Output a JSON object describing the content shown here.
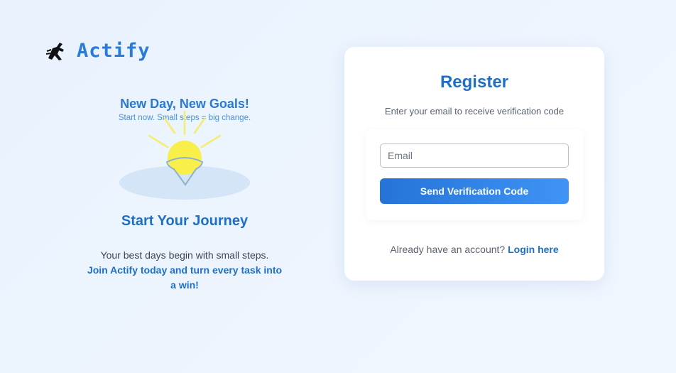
{
  "brand": {
    "name": "Actify",
    "logo_icon": "runner-logo-icon",
    "color": "#2a7bd6"
  },
  "hero": {
    "heading": "New Day, New Goals!",
    "subheading": "Start now. Small steps = big change.",
    "illustration_icon": "sunrise-icon",
    "journey_title": "Start Your Journey",
    "journey_text": "Your best days begin with small steps.",
    "journey_highlight": "Join Actify today and turn every task into a win!"
  },
  "register": {
    "title": "Register",
    "subtitle": "Enter your email to receive verification code",
    "email_placeholder": "Email",
    "email_value": "",
    "send_button": "Send Verification Code",
    "login_prompt": "Already have an account?",
    "login_link": "Login here"
  },
  "colors": {
    "accent": "#1f6fc5",
    "button_start": "#2573d8",
    "button_end": "#3f94f5",
    "sun": "#f9ef4a"
  }
}
